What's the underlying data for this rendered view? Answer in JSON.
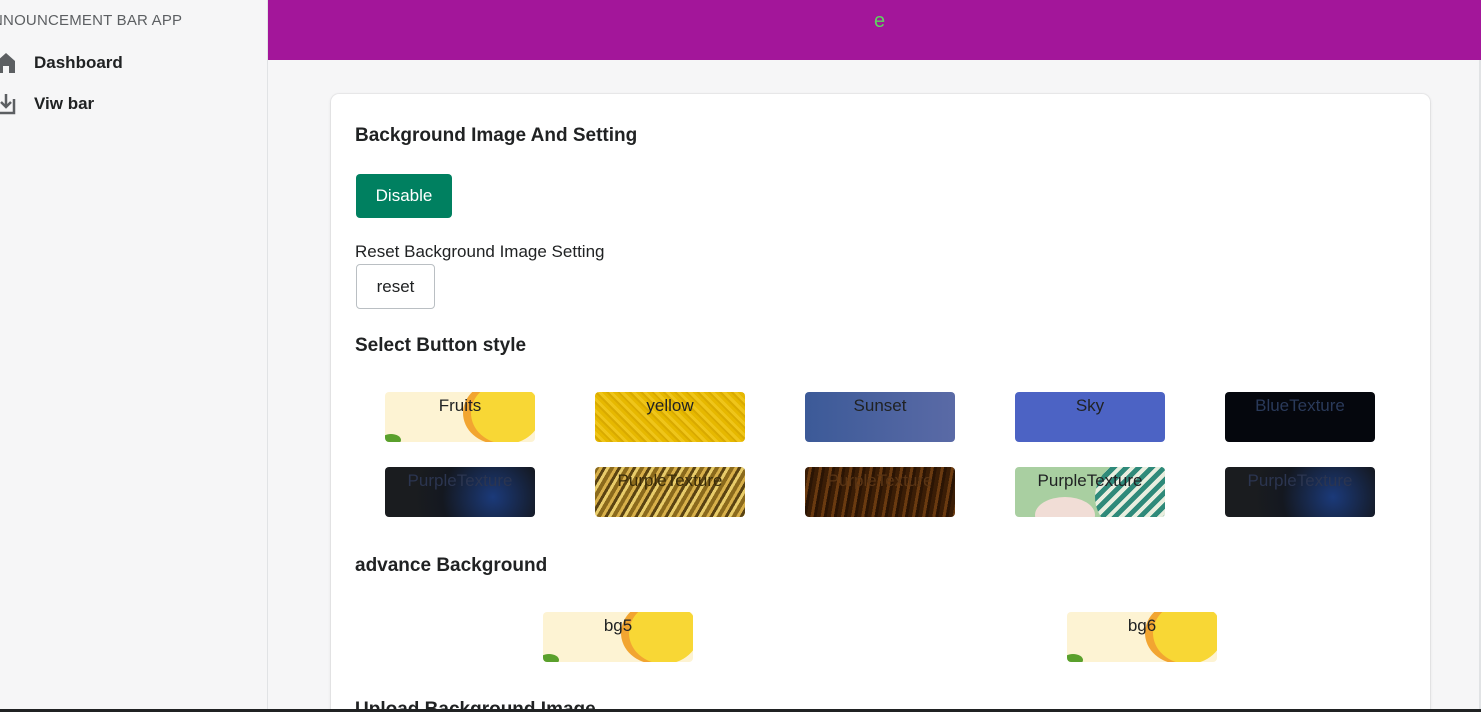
{
  "sidebar": {
    "app_title": "NNOUNCEMENT BAR APP",
    "items": [
      {
        "label": "Dashboard",
        "icon": "home-icon"
      },
      {
        "label": "Viw bar",
        "icon": "download-icon"
      }
    ]
  },
  "topbar": {
    "text": "e",
    "background": "#a3169a",
    "text_color": "#5fd35f"
  },
  "card": {
    "bg_heading": "Background Image And Setting",
    "disable_label": "Disable",
    "reset_section_label": "Reset Background Image Setting",
    "reset_label": "reset",
    "style_heading": "Select Button style",
    "styles": [
      "Fruits",
      "yellow",
      "Sunset",
      "Sky",
      "BlueTexture",
      "PurpleTexture",
      "PurpleTexture",
      "PurpleTexture",
      "PurpleTexture",
      "PurpleTexture"
    ],
    "advance_heading": "advance Background",
    "advance": [
      "bg5",
      "bg6"
    ],
    "upload_heading": "Upload Background Image"
  },
  "colors": {
    "primary_button": "#008060",
    "accent": "#a3169a"
  }
}
